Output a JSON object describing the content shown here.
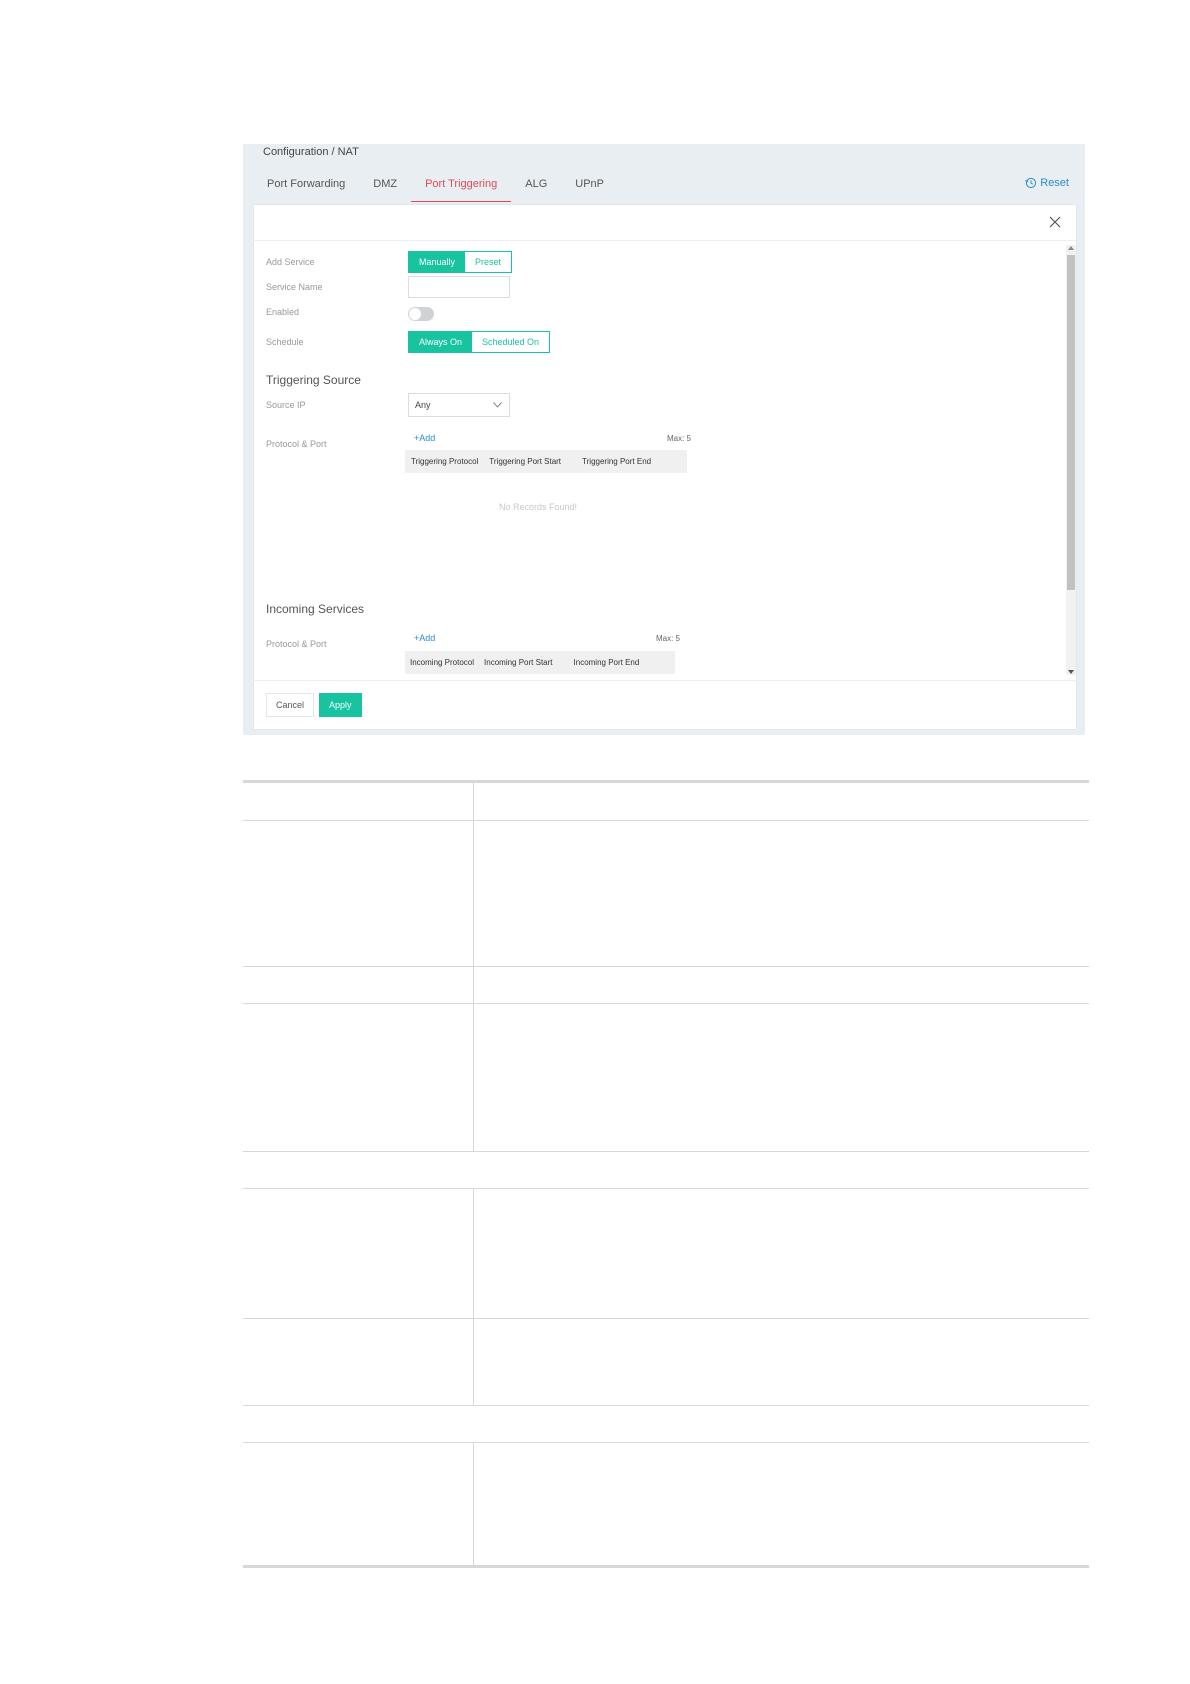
{
  "breadcrumb": "Configuration / NAT",
  "tabs": [
    {
      "label": "Port Forwarding"
    },
    {
      "label": "DMZ"
    },
    {
      "label": "Port Triggering"
    },
    {
      "label": "ALG"
    },
    {
      "label": "UPnP"
    }
  ],
  "active_tab": "Port Triggering",
  "reset_label": "Reset",
  "form": {
    "add_service": {
      "label": "Add Service",
      "options": [
        "Manually",
        "Preset"
      ],
      "selected": "Manually"
    },
    "service_name": {
      "label": "Service Name",
      "value": ""
    },
    "enabled": {
      "label": "Enabled",
      "value": false
    },
    "schedule": {
      "label": "Schedule",
      "options": [
        "Always On",
        "Scheduled On"
      ],
      "selected": "Always On"
    }
  },
  "triggering_source": {
    "title": "Triggering Source",
    "source_ip": {
      "label": "Source IP",
      "value": "Any"
    },
    "protocol_port": {
      "label": "Protocol & Port",
      "add_label": "+Add",
      "max_label": "Max: 5",
      "columns": [
        "Triggering Protocol",
        "Triggering Port Start",
        "Triggering Port End"
      ],
      "empty_text": "No Records Found!"
    }
  },
  "incoming_services": {
    "title": "Incoming Services",
    "protocol_port": {
      "label": "Protocol & Port",
      "add_label": "+Add",
      "max_label": "Max: 5",
      "columns": [
        "Incoming Protocol",
        "Incoming Port Start",
        "Incoming Port End"
      ]
    }
  },
  "footer": {
    "cancel_label": "Cancel",
    "apply_label": "Apply"
  },
  "colors": {
    "accent": "#18c3a0",
    "active_tab": "#e14a56",
    "link": "#2f8ccf"
  }
}
